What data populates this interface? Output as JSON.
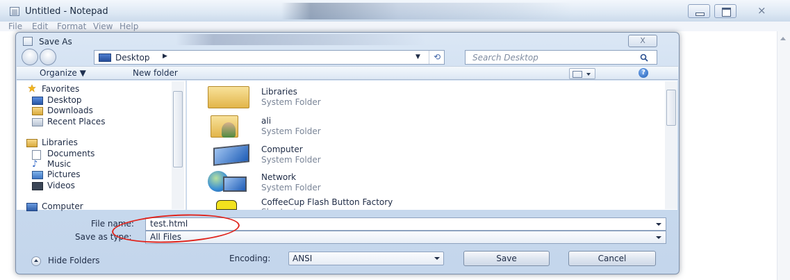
{
  "notepad": {
    "title": "Untitled - Notepad",
    "menu": [
      "File",
      "Edit",
      "Format",
      "View",
      "Help"
    ]
  },
  "dialog": {
    "title": "Save As",
    "close_glyph": "X",
    "address": {
      "location": "Desktop",
      "chevron": "▶",
      "dropdown": "▼"
    },
    "search_placeholder": "Search Desktop",
    "toolbar": {
      "organize": "Organize ▼",
      "new_folder": "New folder",
      "help": "?"
    },
    "nav": {
      "favorites": "Favorites",
      "favorites_items": [
        "Desktop",
        "Downloads",
        "Recent Places"
      ],
      "libraries": "Libraries",
      "libraries_items": [
        "Documents",
        "Music",
        "Pictures",
        "Videos"
      ],
      "computer": "Computer"
    },
    "files": [
      {
        "name": "Libraries",
        "type": "System Folder"
      },
      {
        "name": "ali",
        "type": "System Folder"
      },
      {
        "name": "Computer",
        "type": "System Folder"
      },
      {
        "name": "Network",
        "type": "System Folder"
      },
      {
        "name": "CoffeeCup Flash Button Factory",
        "type": "Shortcut"
      }
    ],
    "file_name_label": "File name:",
    "file_name_value": "test.html",
    "save_type_label": "Save as type:",
    "save_type_value": "All Files",
    "hide_folders": "Hide Folders",
    "encoding_label": "Encoding:",
    "encoding_value": "ANSI",
    "save_label": "Save",
    "cancel_label": "Cancel"
  },
  "colors": {
    "annotation": "#e0231b",
    "accent": "#2a5bb0"
  }
}
